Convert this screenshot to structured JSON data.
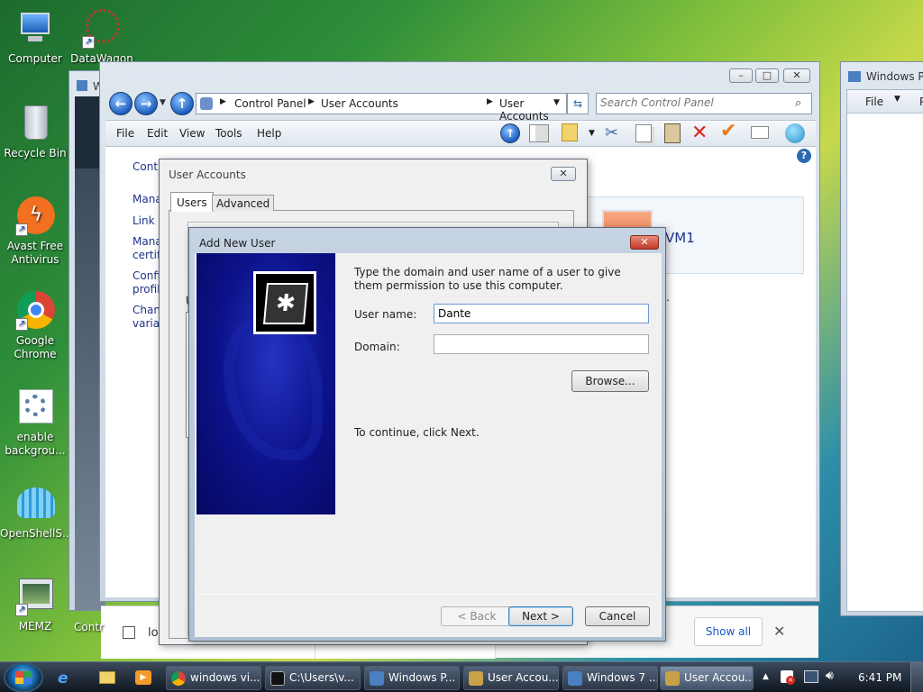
{
  "desktop": {
    "icons": [
      {
        "label": "Computer"
      },
      {
        "label": "DataWagon"
      },
      {
        "label": "Recycle Bin"
      },
      {
        "label": "Avast Free Antivirus"
      },
      {
        "label": "Google Chrome"
      },
      {
        "label": "enable backgrou..."
      },
      {
        "label": "OpenShellS..."
      },
      {
        "label": "MEMZ"
      }
    ]
  },
  "explorer": {
    "breadcrumb": [
      "Control Panel",
      "User Accounts",
      "User Accounts"
    ],
    "search_placeholder": "Search Control Panel",
    "menu": [
      "File",
      "Edit",
      "View",
      "Tools",
      "Help"
    ],
    "left_text": [
      "Contr",
      "Mana",
      "Link c",
      "Mana",
      "certifi",
      "Confi",
      "profil",
      "Chan",
      "variab"
    ],
    "user_tile_text": "VM1",
    "bottom_text": "Contr",
    "period": "."
  },
  "right_window": {
    "title": "Windows Pi",
    "menu": [
      "File",
      "P"
    ]
  },
  "back_window": {
    "title": "W"
  },
  "user_accounts_dialog": {
    "title": "User Accounts",
    "tabs": [
      "Users",
      "Advanced"
    ],
    "left_fragment": "U"
  },
  "add_new_user": {
    "title": "Add New User",
    "intro": "Type the domain and user name of a user to give them permission to use this computer.",
    "username_label": "User name:",
    "username_value": "Dante",
    "domain_label": "Domain:",
    "domain_value": "",
    "browse_label": "Browse...",
    "continue_text": "To continue, click Next.",
    "back_label": "< Back",
    "next_label": "Next >",
    "cancel_label": "Cancel"
  },
  "download_bar": {
    "filename": "logon.jp",
    "show_all": "Show all"
  },
  "taskbar": {
    "tasks": [
      {
        "label": "windows vi...",
        "color": "#e24b3a"
      },
      {
        "label": "C:\\Users\\v...",
        "color": "#333333"
      },
      {
        "label": "Windows P...",
        "color": "#4a7fc1"
      },
      {
        "label": "User Accou...",
        "color": "#c9a14a"
      },
      {
        "label": "Windows 7 ...",
        "color": "#4a7fc1"
      },
      {
        "label": "User Accou...",
        "color": "#c9a14a"
      }
    ],
    "clock": "6:41 PM"
  }
}
